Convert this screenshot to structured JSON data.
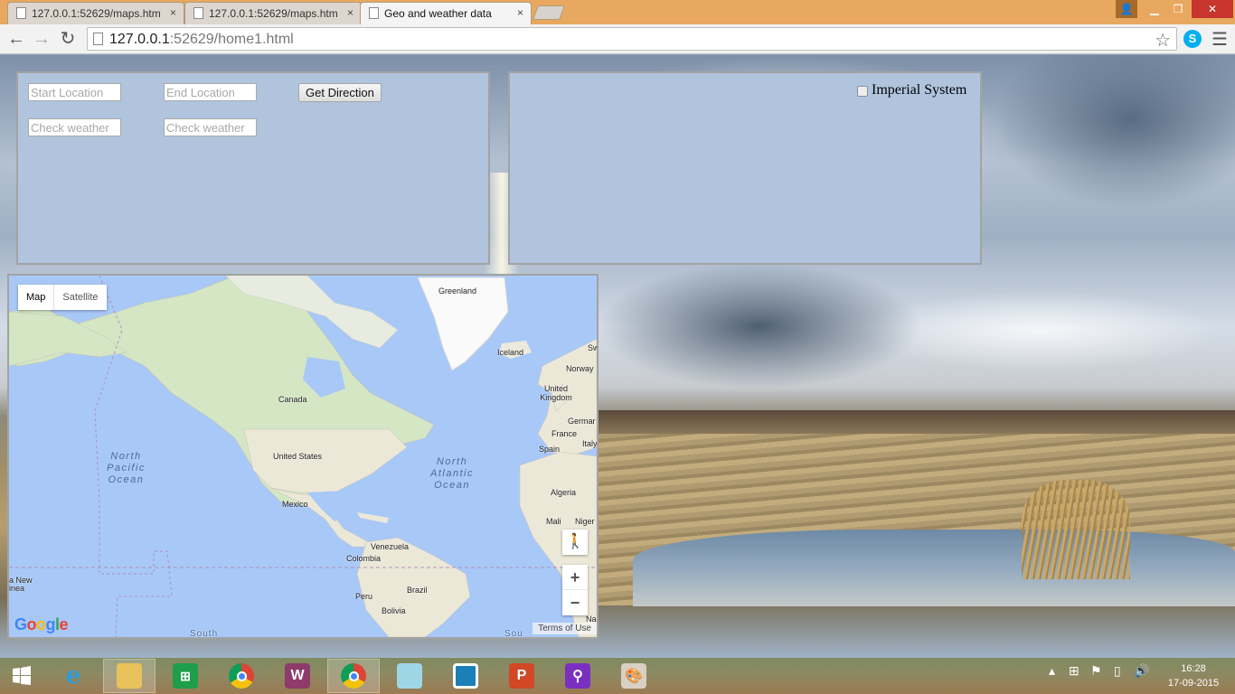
{
  "browser": {
    "tabs": [
      {
        "title": "127.0.0.1:52629/maps.htm",
        "active": false
      },
      {
        "title": "127.0.0.1:52629/maps.htm",
        "active": false
      },
      {
        "title": "Geo and weather data",
        "active": true
      }
    ],
    "tab_close": "×",
    "url_host": "127.0.0.1",
    "url_rest": ":52629/home1.html"
  },
  "form": {
    "start_placeholder": "Start Location",
    "end_placeholder": "End Location",
    "get_direction": "Get Direction",
    "weather1_placeholder": "Check weather",
    "weather2_placeholder": "Check weather"
  },
  "settings": {
    "imperial_label": "Imperial System",
    "imperial_checked": false
  },
  "map": {
    "type_map": "Map",
    "type_satellite": "Satellite",
    "zoom_in": "+",
    "zoom_out": "−",
    "logo": "Google",
    "terms": "Terms of Use",
    "labels": {
      "greenland": "Greenland",
      "iceland": "Iceland",
      "norway": "Norway",
      "canada": "Canada",
      "uk": "United Kingdom",
      "germany": "Germar",
      "france": "France",
      "italy": "Italy",
      "spain": "Spain",
      "us": "United States",
      "mexico": "Mexico",
      "algeria": "Algeria",
      "mali": "Mali",
      "niger": "Niger",
      "venezuela": "Venezuela",
      "colombia": "Colombia",
      "peru": "Peru",
      "brazil": "Brazil",
      "bolivia": "Bolivia",
      "new_guinea": "a New\ninea",
      "sw": "Sw",
      "nar": "Nar",
      "south": "South",
      "sou": "Sou"
    },
    "oceans": {
      "north_pacific": "North\nPacific\nOcean",
      "north_atlantic": "North\nAtlantic\nOcean"
    }
  },
  "taskbar": {
    "time": "16:28",
    "date": "17-09-2015"
  },
  "colors": {
    "panel_bg": "#b0c4de",
    "land": "#e8e6d6",
    "water": "#a8c8f8",
    "tabstrip": "#e8a860"
  }
}
